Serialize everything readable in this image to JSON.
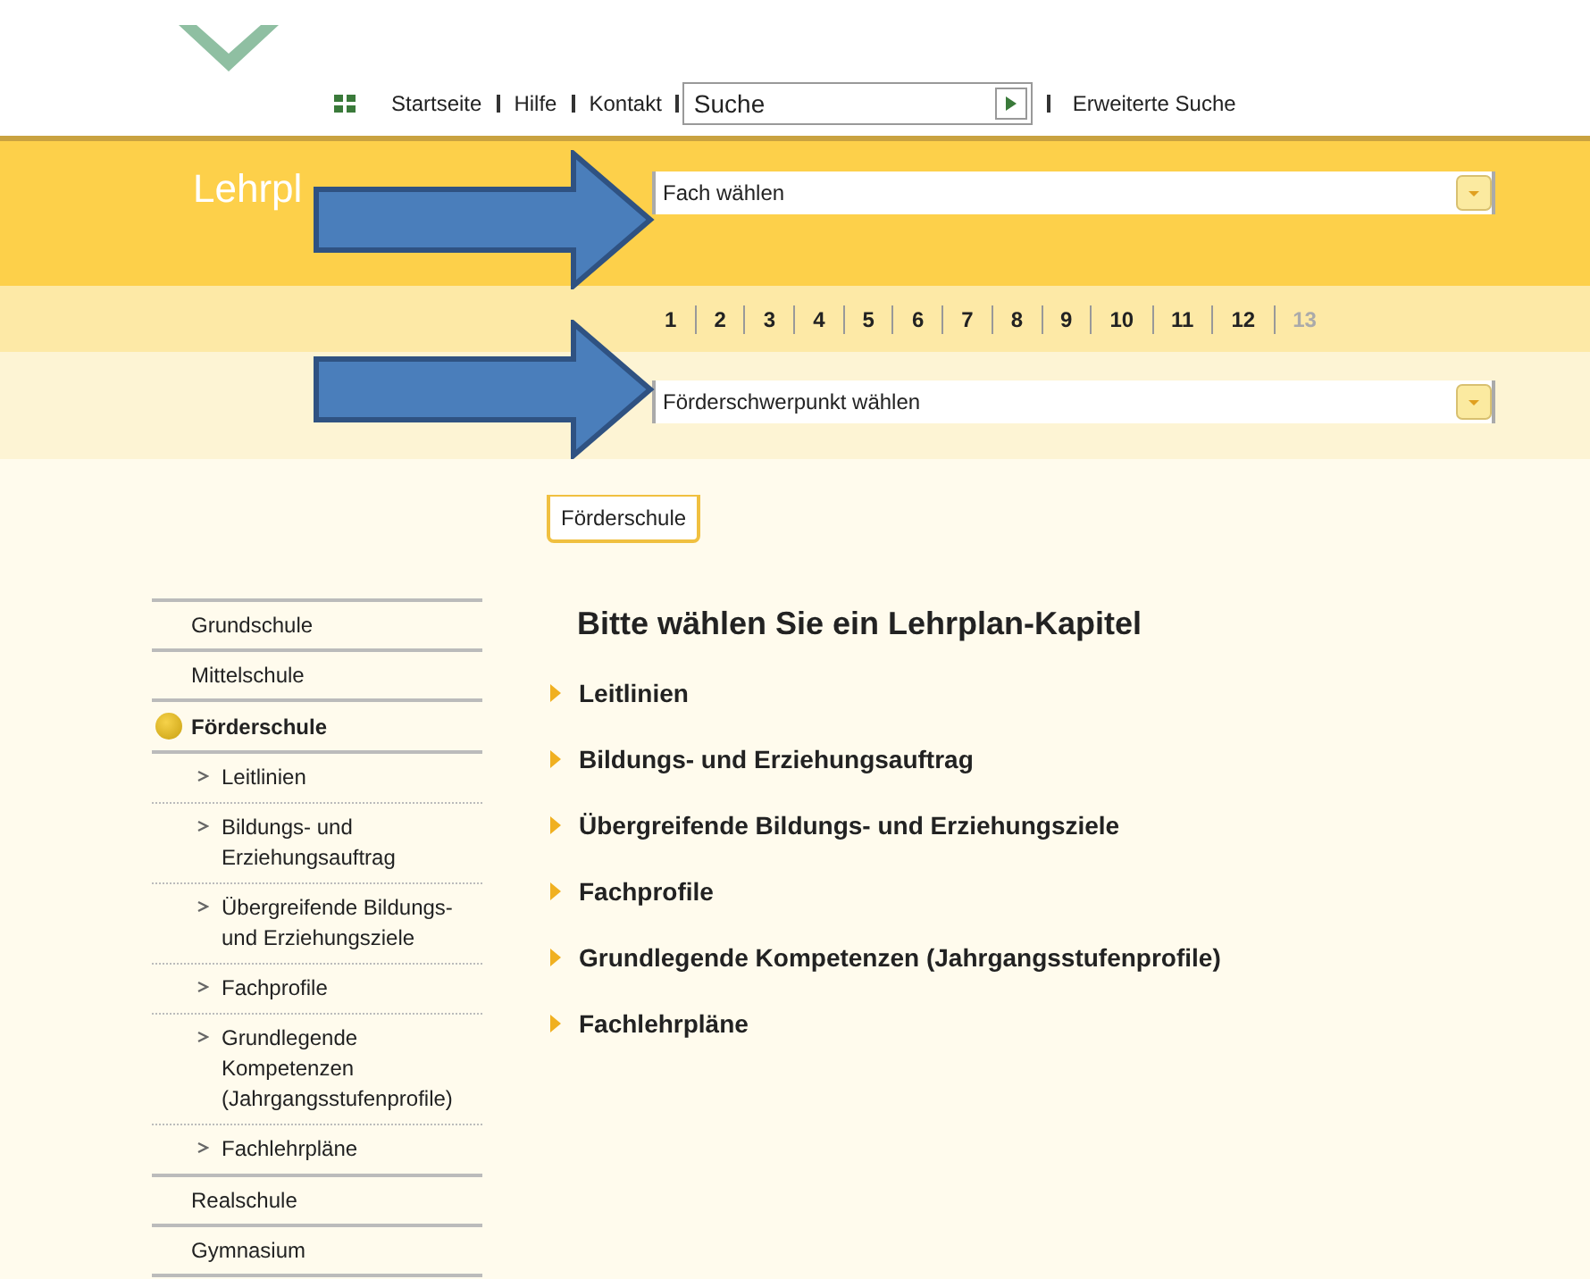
{
  "logo": {
    "text": "Lehrpl"
  },
  "nav": {
    "links": [
      "Startseite",
      "Hilfe",
      "Kontakt"
    ],
    "search": {
      "placeholder": "Suche"
    },
    "advanced_link": "Erweiterte Suche"
  },
  "subject_select": {
    "value": "Fach wählen"
  },
  "grades": [
    {
      "label": "1",
      "disabled": false
    },
    {
      "label": "2",
      "disabled": false
    },
    {
      "label": "3",
      "disabled": false
    },
    {
      "label": "4",
      "disabled": false
    },
    {
      "label": "5",
      "disabled": false
    },
    {
      "label": "6",
      "disabled": false
    },
    {
      "label": "7",
      "disabled": false
    },
    {
      "label": "8",
      "disabled": false
    },
    {
      "label": "9",
      "disabled": false
    },
    {
      "label": "10",
      "disabled": false
    },
    {
      "label": "11",
      "disabled": false
    },
    {
      "label": "12",
      "disabled": false
    },
    {
      "label": "13",
      "disabled": true
    }
  ],
  "focus_select": {
    "value": "Förderschwerpunkt wählen"
  },
  "school_tab": {
    "label": "Förderschule",
    "selected": true
  },
  "sidebar": {
    "items": [
      {
        "label": "Grundschule",
        "selected": false
      },
      {
        "label": "Mittelschule",
        "selected": false
      },
      {
        "label": "Förderschule",
        "selected": true,
        "children": [
          {
            "label": "Leitlinien"
          },
          {
            "label": "Bildungs- und Erziehungsauftrag"
          },
          {
            "label": "Übergreifende Bildungs- und Erziehungsziele"
          },
          {
            "label": "Fachprofile"
          },
          {
            "label": "Grundlegende Kompetenzen (Jahrgangsstufenprofile)"
          },
          {
            "label": "Fachlehrpläne"
          }
        ]
      },
      {
        "label": "Realschule",
        "selected": false
      },
      {
        "label": "Gymnasium",
        "selected": false
      }
    ]
  },
  "content": {
    "heading": "Bitte wählen Sie ein Lehrplan-Kapitel",
    "chapters": [
      "Leitlinien",
      "Bildungs- und Erziehungsauftrag",
      "Übergreifende Bildungs- und Erziehungsziele",
      "Fachprofile",
      "Grundlegende Kompetenzen (Jahrgangsstufenprofile)",
      "Fachlehrpläne"
    ]
  },
  "annotations": [
    {
      "kind": "arrow"
    },
    {
      "kind": "arrow"
    }
  ]
}
